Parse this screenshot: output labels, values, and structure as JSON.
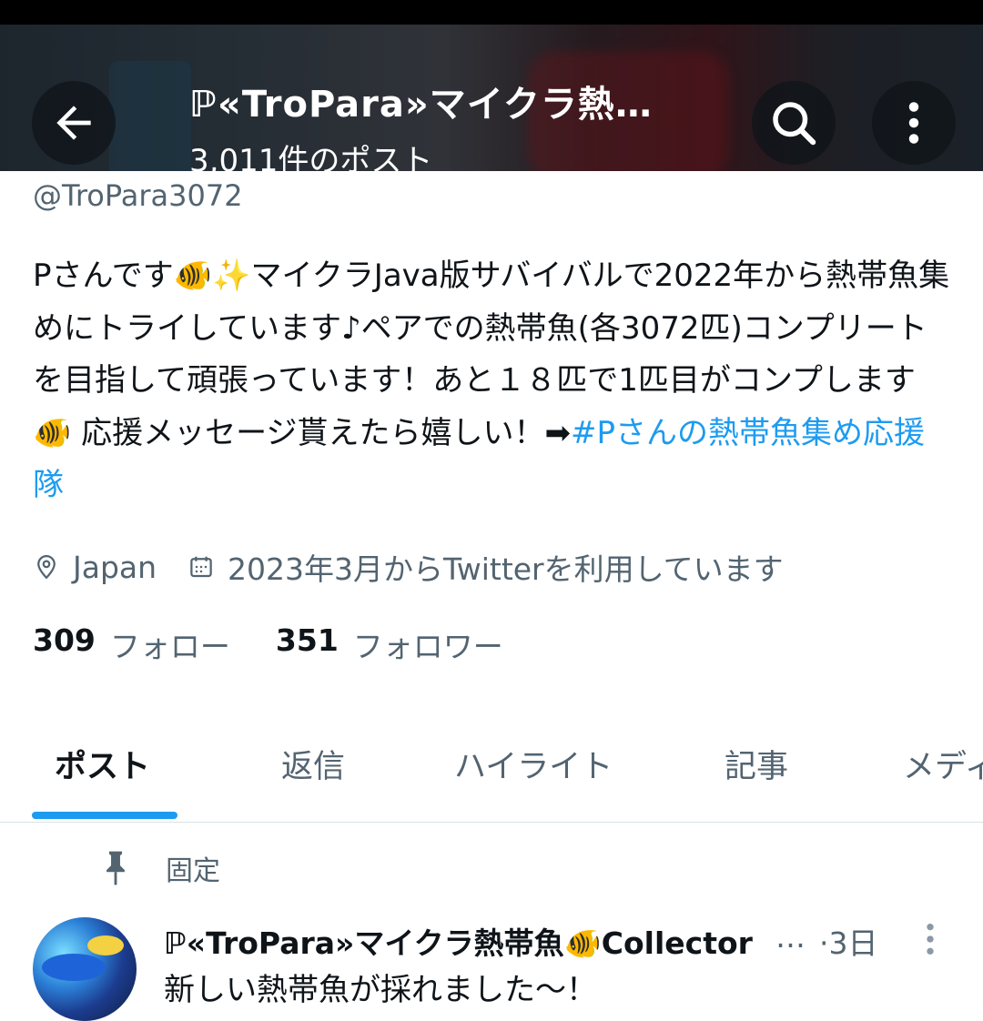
{
  "header": {
    "title": "ℙ«TroPara»マイクラ熱…",
    "post_count": "3,011件のポスト",
    "back_icon": "arrow-left-icon",
    "search_icon": "search-icon",
    "more_icon": "more-vertical-icon"
  },
  "profile": {
    "handle": "@TroPara3072",
    "bio_part1": "Pさんです🐠✨マイクラJava版サバイバルで2022年から熱帯魚集めにトライしています♪ペアでの熱帯魚(各3072匹)コンプリートを目指して頑張っています！あと１８匹で1匹目がコンプします🐠 応援メッセージ貰えたら嬉しい！➡",
    "bio_hashtag": "#Pさんの熱帯魚集め応援隊",
    "location": "Japan",
    "joined": "2023年3月からTwitterを利用しています",
    "following_count": "309",
    "following_label": "フォロー",
    "followers_count": "351",
    "followers_label": "フォロワー"
  },
  "tabs": [
    "ポスト",
    "返信",
    "ハイライト",
    "記事",
    "メディア"
  ],
  "active_tab": "ポスト",
  "pinned_tweet": {
    "pinned_label": "固定",
    "author": "ℙ«TroPara»マイクラ熱帯魚🐠Collector",
    "ellipsis": "…",
    "time": "·3日",
    "text": "新しい熱帯魚が採れました〜！"
  },
  "colors": {
    "accent": "#1d9bf0",
    "text": "#0f1419",
    "secondary": "#536471"
  }
}
